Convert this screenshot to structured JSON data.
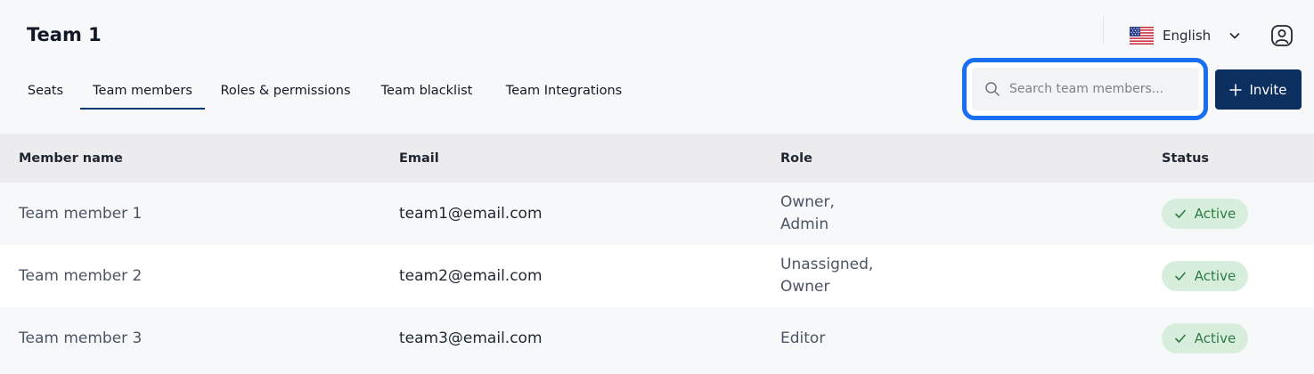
{
  "header": {
    "title": "Team 1",
    "language": {
      "label": "English",
      "flag_icon": "us-flag-icon"
    }
  },
  "tabs": [
    {
      "label": "Seats",
      "active": false
    },
    {
      "label": "Team members",
      "active": true
    },
    {
      "label": "Roles & permissions",
      "active": false
    },
    {
      "label": "Team blacklist",
      "active": false
    },
    {
      "label": "Team Integrations",
      "active": false
    }
  ],
  "search": {
    "placeholder": "Search team members...",
    "value": ""
  },
  "invite": {
    "label": "Invite"
  },
  "table": {
    "columns": [
      "Member name",
      "Email",
      "Role",
      "Status"
    ],
    "rows": [
      {
        "name": "Team member 1",
        "email": "team1@email.com",
        "role_lines": [
          "Owner,",
          "Admin"
        ],
        "status": "Active"
      },
      {
        "name": "Team member 2",
        "email": "team2@email.com",
        "role_lines": [
          "Unassigned,",
          "Owner"
        ],
        "status": "Active"
      },
      {
        "name": "Team member 3",
        "email": "team3@email.com",
        "role_lines": [
          "Editor"
        ],
        "status": "Active"
      }
    ]
  },
  "colors": {
    "accent": "#0b2f5e",
    "focus_ring": "#1a6ef2",
    "status_bg": "#d7eedc",
    "status_text": "#2f7a45"
  }
}
